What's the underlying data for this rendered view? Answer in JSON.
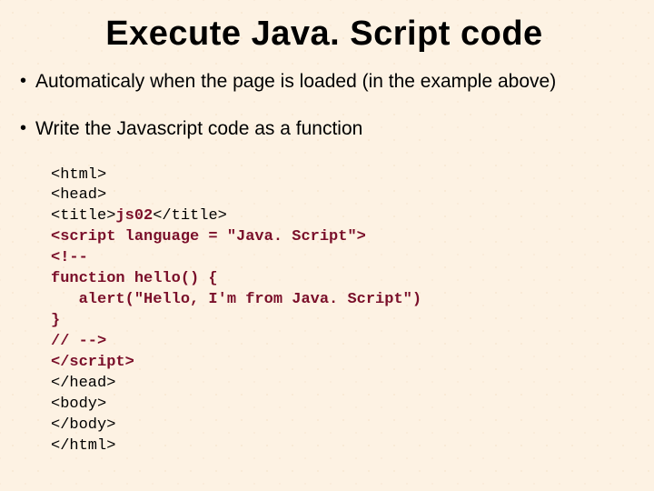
{
  "title": "Execute Java. Script code",
  "bullets": [
    "Automaticaly when the page is loaded (in the example above)",
    "Write the Javascript code as a function"
  ],
  "code": {
    "l01": "<html>",
    "l02": "<head>",
    "l03a": "<title>",
    "l03b": "js02",
    "l03c": "</title>",
    "l04": "<script language = \"Java. Script\">",
    "l05": "<!--",
    "l06": "function hello() {",
    "l07": "   alert(\"Hello, I'm from Java. Script\")",
    "l08": "}",
    "l09": "// -->",
    "l10a": "</scr",
    "l10b": "ipt>",
    "l11": "</head>",
    "l12": "<body>",
    "l13": "</body>",
    "l14": "</html>"
  }
}
